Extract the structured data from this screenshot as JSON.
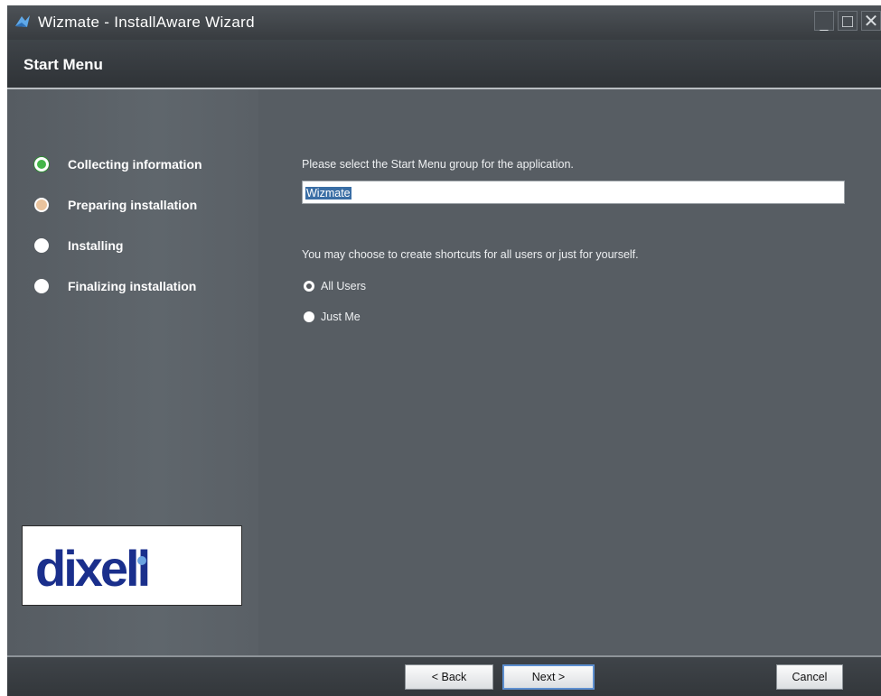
{
  "window": {
    "title": "Wizmate - InstallAware Wizard",
    "controls": {
      "minimize": "_",
      "maximize": "□",
      "close": "✕"
    }
  },
  "header": {
    "title": "Start Menu"
  },
  "steps": [
    {
      "label": "Collecting information",
      "status": "active"
    },
    {
      "label": "Preparing installation",
      "status": "pending"
    },
    {
      "label": "Installing",
      "status": "todo"
    },
    {
      "label": "Finalizing installation",
      "status": "todo"
    }
  ],
  "logo": {
    "text": "dixell"
  },
  "content": {
    "group_prompt": "Please select the Start Menu group for the application.",
    "group_value": "Wizmate",
    "shortcut_prompt": "You may choose to create shortcuts for all users or just for yourself.",
    "options": [
      {
        "label": "All Users",
        "checked": true
      },
      {
        "label": "Just Me",
        "checked": false
      }
    ]
  },
  "buttons": {
    "back": "< Back",
    "next": "Next >",
    "cancel": "Cancel"
  },
  "colors": {
    "accent": "#43b649",
    "panel": "#575d63",
    "selection": "#3a6ea5",
    "logo_blue": "#1a2f8c"
  }
}
